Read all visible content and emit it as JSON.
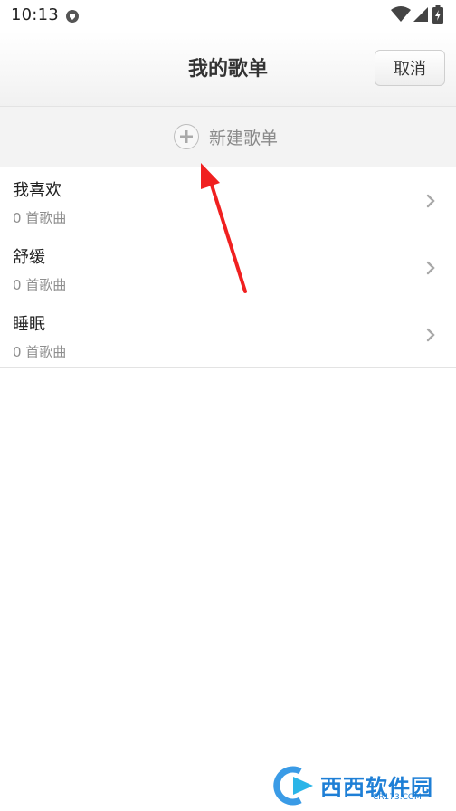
{
  "status_bar": {
    "time": "10:13",
    "icons": [
      "shield-app-icon",
      "wifi-icon",
      "signal-icon",
      "battery-icon"
    ]
  },
  "header": {
    "title": "我的歌单",
    "cancel_label": "取消"
  },
  "new_playlist": {
    "label": "新建歌单",
    "icon": "plus-icon"
  },
  "playlists": [
    {
      "name": "我喜欢",
      "count": "0 首歌曲"
    },
    {
      "name": "舒缓",
      "count": "0 首歌曲"
    },
    {
      "name": "睡眠",
      "count": "0 首歌曲"
    }
  ],
  "colors": {
    "annotation_arrow": "#f02020",
    "header_bg": "#f4f4f4",
    "new_row_bg": "#f3f3f3",
    "watermark": "#1e7fd6"
  },
  "watermark": {
    "text": "西西软件园",
    "sub": "CR173.COM"
  }
}
